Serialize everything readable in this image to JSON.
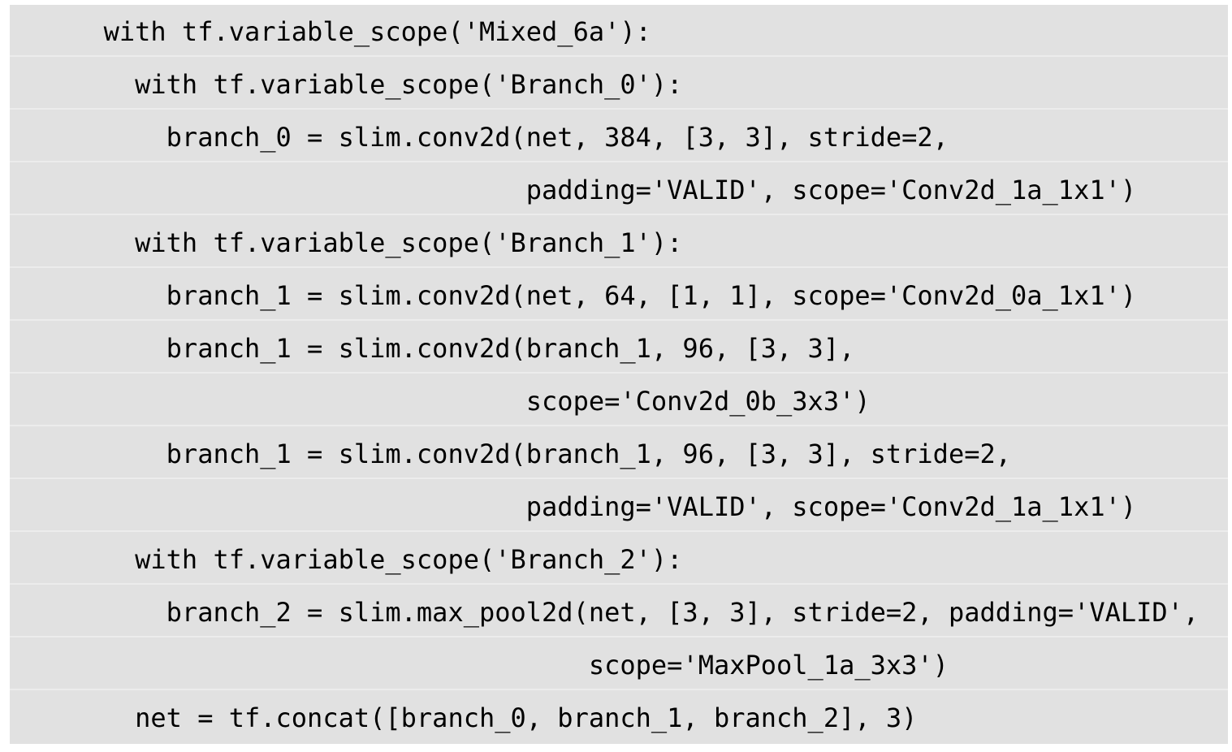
{
  "code": {
    "lines": [
      "      with tf.variable_scope('Mixed_6a'):",
      "        with tf.variable_scope('Branch_0'):",
      "          branch_0 = slim.conv2d(net, 384, [3, 3], stride=2,",
      "                                 padding='VALID', scope='Conv2d_1a_1x1')",
      "        with tf.variable_scope('Branch_1'):",
      "          branch_1 = slim.conv2d(net, 64, [1, 1], scope='Conv2d_0a_1x1')",
      "          branch_1 = slim.conv2d(branch_1, 96, [3, 3],",
      "                                 scope='Conv2d_0b_3x3')",
      "          branch_1 = slim.conv2d(branch_1, 96, [3, 3], stride=2,",
      "                                 padding='VALID', scope='Conv2d_1a_1x1')",
      "        with tf.variable_scope('Branch_2'):",
      "          branch_2 = slim.max_pool2d(net, [3, 3], stride=2, padding='VALID',",
      "                                     scope='MaxPool_1a_3x3')",
      "        net = tf.concat([branch_0, branch_1, branch_2], 3)"
    ]
  },
  "colors": {
    "background": "#e1e1e1",
    "text": "#000000"
  }
}
